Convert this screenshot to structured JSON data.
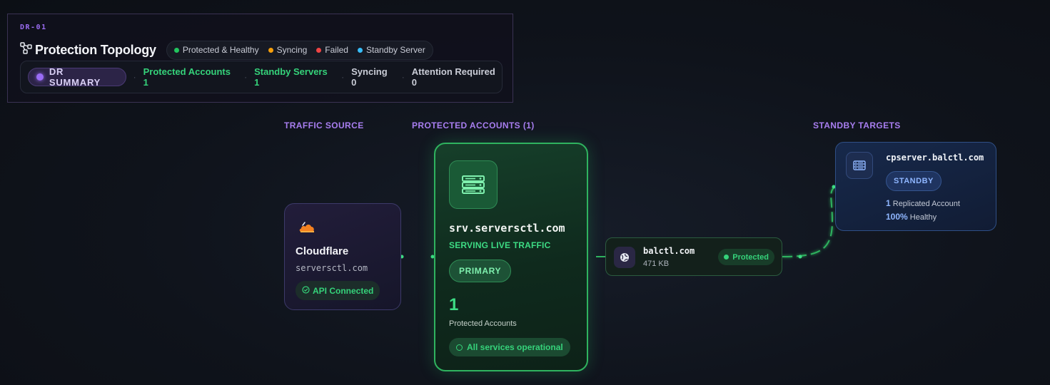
{
  "header": {
    "code": "DR-01",
    "title": "Protection Topology",
    "legend": [
      {
        "label": "Protected & Healthy",
        "color": "#22c55e"
      },
      {
        "label": "Syncing",
        "color": "#f59e0b"
      },
      {
        "label": "Failed",
        "color": "#ef4444"
      },
      {
        "label": "Standby Server",
        "color": "#38bdf8"
      }
    ],
    "summary": {
      "pill_label": "DR SUMMARY",
      "protected_accounts": "Protected Accounts 1",
      "standby_servers": "Standby Servers 1",
      "syncing": "Syncing 0",
      "attention": "Attention Required 0"
    }
  },
  "columns": {
    "traffic_source": "TRAFFIC SOURCE",
    "protected_accounts": "PROTECTED ACCOUNTS (1)",
    "standby_targets": "STANDBY TARGETS"
  },
  "source": {
    "name": "Cloudflare",
    "domain": "serversctl.com",
    "status": "API Connected",
    "icon": "cloudflare-icon"
  },
  "primary": {
    "host": "srv.serversctl.com",
    "status": "SERVING LIVE TRAFFIC",
    "role": "PRIMARY",
    "count": "1",
    "count_label": "Protected Accounts",
    "health": "All services operational",
    "icon": "server-icon"
  },
  "account": {
    "name": "balctl.com",
    "size": "471 KB",
    "status": "Protected",
    "icon": "globe-icon"
  },
  "standby": {
    "host": "cpserver.balctl.com",
    "role": "STANDBY",
    "replicated_count": "1",
    "replicated_label": "Replicated Account",
    "healthy_pct": "100%",
    "healthy_label": "Healthy",
    "icon": "server-icon"
  },
  "colors": {
    "accent_purple": "#9a6cf0",
    "green": "#35d27a",
    "blue": "#8fb6ff",
    "text_muted": "#c9ccd6"
  }
}
